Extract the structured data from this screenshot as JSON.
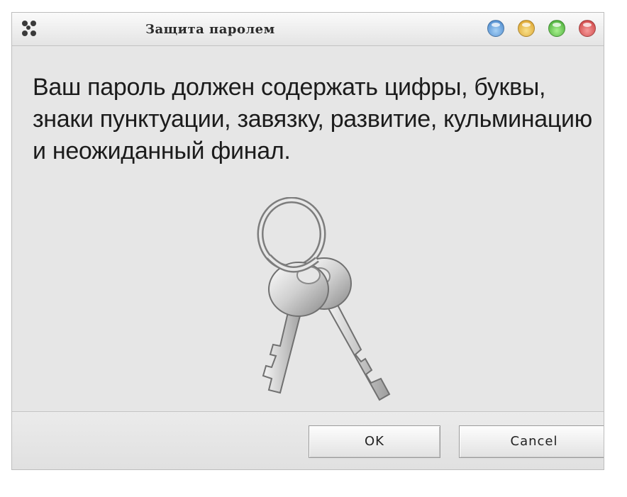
{
  "window": {
    "title": "Защита паролем"
  },
  "title_buttons": [
    "info",
    "minimize",
    "maximize",
    "close"
  ],
  "message": "Ваш пароль должен содержать цифры, буквы, знаки пунктуации, завязку, развитие, кульминацию и неожиданный финал.",
  "icons": {
    "app": "app-icon",
    "main": "keys-icon"
  },
  "buttons": {
    "ok_label": "OK",
    "cancel_label": "Cancel"
  },
  "colors": {
    "window_bg": "#e6e6e6",
    "text": "#1c1c1c",
    "blue_button": "#3f7fc8",
    "yellow_button": "#d99a1e",
    "green_button": "#3aa32a",
    "red_button": "#c93636"
  }
}
